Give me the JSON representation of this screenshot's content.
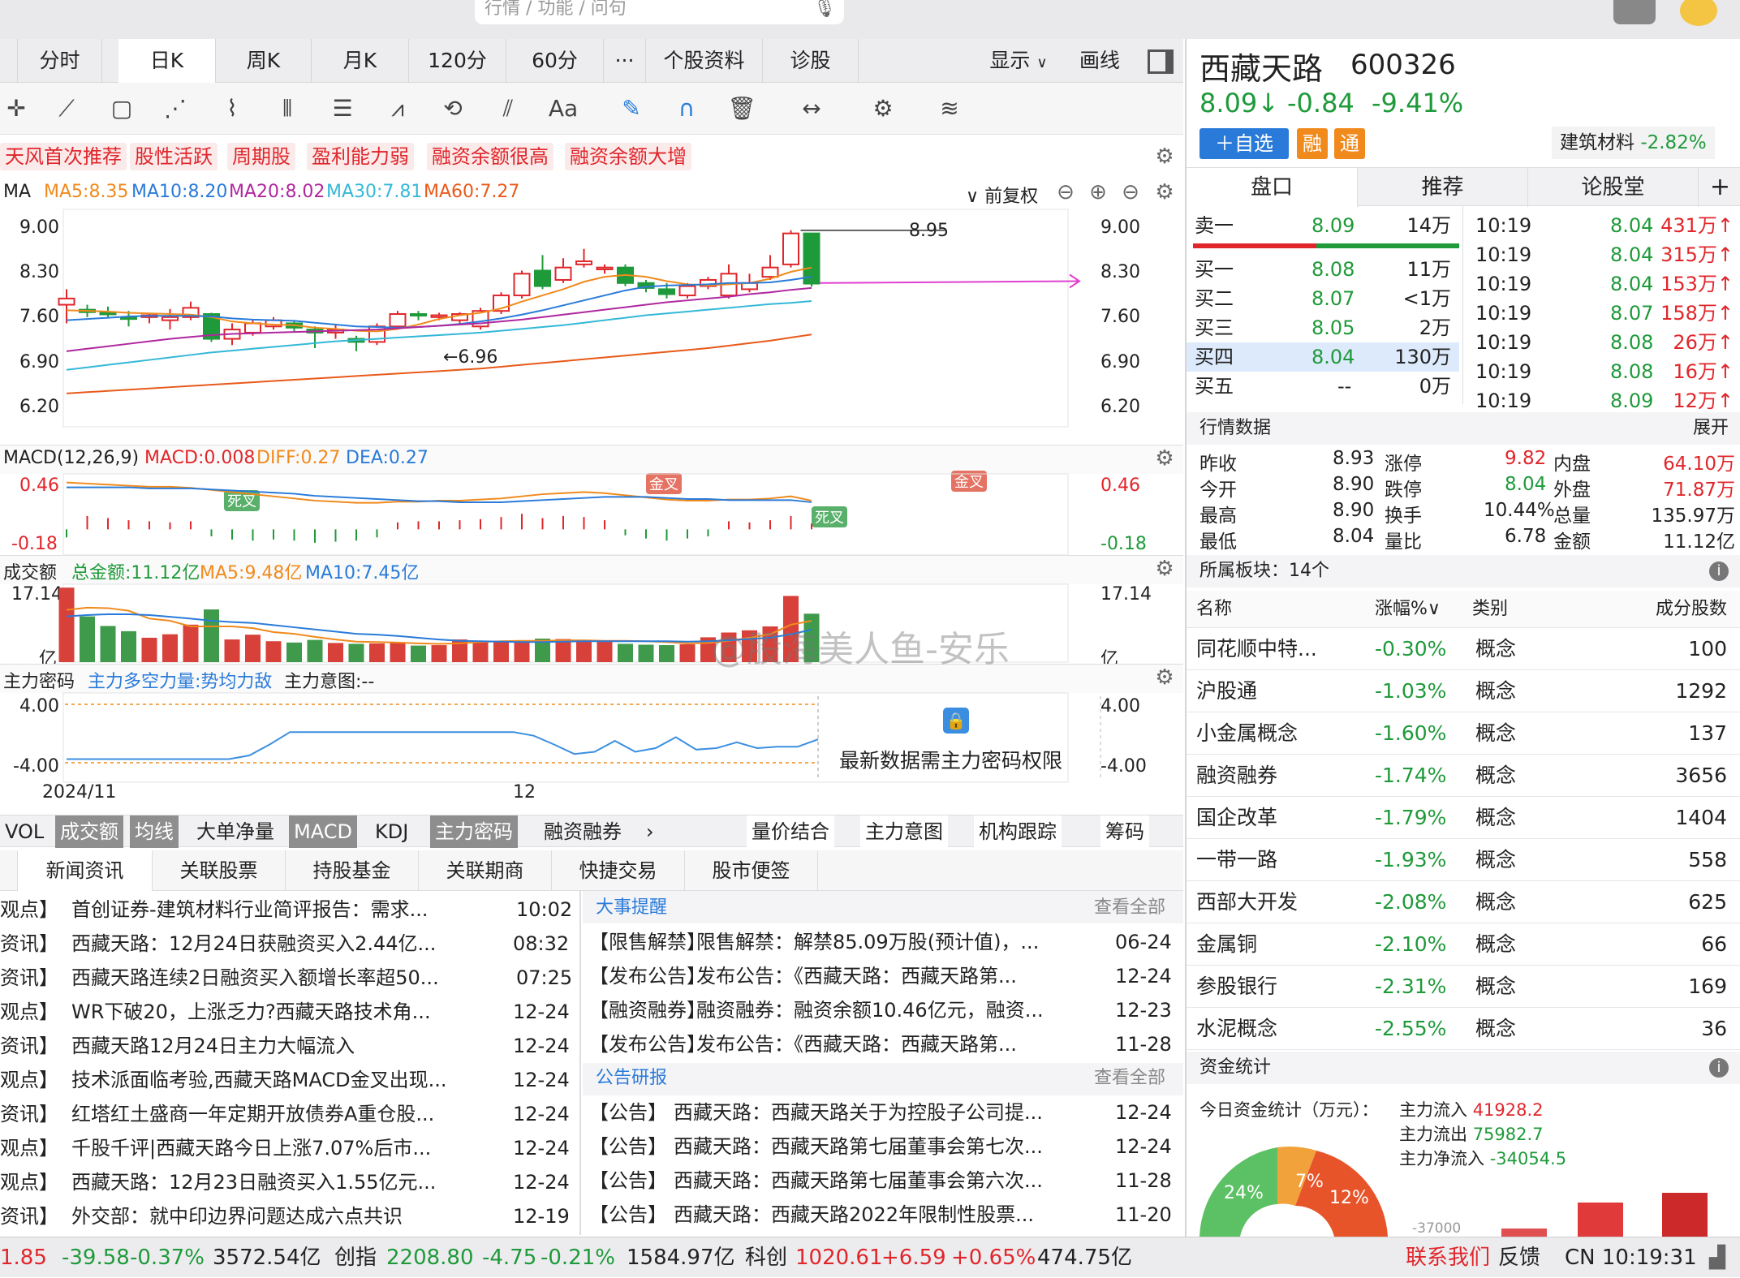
{
  "search": {
    "placeholder": "行情 / 功能 / 问句"
  },
  "period_tabs": [
    "分时",
    "日K",
    "周K",
    "月K",
    "120分",
    "60分",
    "···",
    "个股资料",
    "诊股"
  ],
  "top_right": {
    "display": "显示",
    "draw": "画线"
  },
  "tags": [
    "天风首次推荐",
    "股性活跃",
    "周期股",
    "盈利能力弱",
    "融资余额很高",
    "融资余额大增"
  ],
  "ma_bar": {
    "name": "MA",
    "ma5": "MA5:8.35",
    "ma10": "MA10:8.20",
    "ma20": "MA20:8.02",
    "ma30": "MA30:7.81",
    "ma60": "MA60:7.27",
    "adjust": "前复权"
  },
  "colors": {
    "up": "#e0262b",
    "down": "#1f9a3a",
    "ma5": "#f08a1c",
    "ma10": "#2a7bd9",
    "ma20": "#b0279f",
    "ma30": "#34b8d8",
    "ma60": "#e85a1a"
  },
  "chart_data": [
    {
      "type": "candlestick",
      "title": "日K",
      "ylim": [
        6.2,
        9.0
      ],
      "yticks": [
        "9.00",
        "8.30",
        "7.60",
        "6.90",
        "6.20"
      ],
      "annotations": [
        "8.95",
        "←6.96"
      ],
      "candles": [
        [
          7.75,
          7.85,
          7.45,
          8.0
        ],
        [
          7.67,
          7.63,
          7.55,
          7.75
        ],
        [
          7.62,
          7.6,
          7.55,
          7.72
        ],
        [
          7.55,
          7.52,
          7.4,
          7.65
        ],
        [
          7.55,
          7.58,
          7.45,
          7.62
        ],
        [
          7.5,
          7.55,
          7.35,
          7.68
        ],
        [
          7.55,
          7.7,
          7.5,
          7.8
        ],
        [
          7.6,
          7.2,
          7.15,
          7.62
        ],
        [
          7.2,
          7.35,
          7.1,
          7.45
        ],
        [
          7.3,
          7.45,
          7.25,
          7.5
        ],
        [
          7.4,
          7.5,
          7.35,
          7.55
        ],
        [
          7.45,
          7.38,
          7.3,
          7.5
        ],
        [
          7.35,
          7.3,
          7.05,
          7.4
        ],
        [
          7.3,
          7.35,
          7.2,
          7.42
        ],
        [
          7.2,
          7.15,
          7.0,
          7.25
        ],
        [
          7.15,
          7.4,
          7.1,
          7.45
        ],
        [
          7.4,
          7.6,
          7.35,
          7.65
        ],
        [
          7.6,
          7.58,
          7.5,
          7.65
        ],
        [
          7.55,
          7.58,
          7.5,
          7.62
        ],
        [
          7.5,
          7.6,
          7.45,
          7.63
        ],
        [
          7.4,
          7.65,
          7.35,
          7.7
        ],
        [
          7.65,
          7.9,
          7.6,
          7.95
        ],
        [
          7.9,
          8.25,
          7.85,
          8.3
        ],
        [
          8.3,
          8.05,
          8.0,
          8.55
        ],
        [
          8.15,
          8.35,
          8.1,
          8.5
        ],
        [
          8.4,
          8.45,
          8.35,
          8.65
        ],
        [
          8.32,
          8.35,
          8.25,
          8.4
        ],
        [
          8.35,
          8.1,
          8.05,
          8.4
        ],
        [
          8.1,
          8.02,
          7.95,
          8.15
        ],
        [
          8.0,
          7.92,
          7.85,
          8.1
        ],
        [
          7.9,
          8.05,
          7.85,
          8.1
        ],
        [
          8.05,
          8.15,
          8.0,
          8.2
        ],
        [
          7.9,
          8.25,
          7.85,
          8.4
        ],
        [
          8.0,
          8.1,
          7.95,
          8.25
        ],
        [
          8.2,
          8.35,
          8.15,
          8.55
        ],
        [
          8.4,
          8.9,
          8.35,
          8.95
        ],
        [
          8.9,
          8.09,
          8.04,
          8.9
        ]
      ],
      "series": [
        {
          "name": "MA5",
          "values": [
            7.66,
            7.65,
            7.64,
            7.62,
            7.61,
            7.6,
            7.59,
            7.55,
            7.48,
            7.45,
            7.43,
            7.42,
            7.38,
            7.36,
            7.33,
            7.32,
            7.36,
            7.43,
            7.52,
            7.58,
            7.62,
            7.69,
            7.8,
            7.9,
            8.0,
            8.12,
            8.2,
            8.23,
            8.2,
            8.13,
            8.08,
            8.06,
            8.08,
            8.1,
            8.17,
            8.28,
            8.35
          ]
        },
        {
          "name": "MA10",
          "values": [
            7.5,
            7.52,
            7.54,
            7.56,
            7.57,
            7.57,
            7.57,
            7.56,
            7.53,
            7.51,
            7.5,
            7.49,
            7.46,
            7.43,
            7.4,
            7.39,
            7.38,
            7.39,
            7.41,
            7.44,
            7.48,
            7.53,
            7.59,
            7.66,
            7.74,
            7.82,
            7.9,
            7.98,
            8.04,
            8.06,
            8.07,
            8.08,
            8.1,
            8.1,
            8.11,
            8.15,
            8.2
          ]
        },
        {
          "name": "MA20",
          "values": [
            7.0,
            7.04,
            7.08,
            7.12,
            7.16,
            7.2,
            7.23,
            7.26,
            7.28,
            7.29,
            7.3,
            7.31,
            7.32,
            7.33,
            7.34,
            7.35,
            7.37,
            7.39,
            7.41,
            7.43,
            7.45,
            7.48,
            7.51,
            7.55,
            7.59,
            7.63,
            7.67,
            7.71,
            7.75,
            7.79,
            7.82,
            7.85,
            7.88,
            7.92,
            7.95,
            7.99,
            8.02
          ]
        },
        {
          "name": "MA30",
          "values": [
            6.7,
            6.74,
            6.78,
            6.82,
            6.86,
            6.9,
            6.94,
            6.98,
            7.01,
            7.04,
            7.07,
            7.1,
            7.13,
            7.16,
            7.18,
            7.2,
            7.22,
            7.24,
            7.26,
            7.28,
            7.3,
            7.33,
            7.36,
            7.39,
            7.42,
            7.46,
            7.5,
            7.54,
            7.58,
            7.61,
            7.64,
            7.67,
            7.7,
            7.73,
            7.76,
            7.78,
            7.81
          ]
        },
        {
          "name": "MA60",
          "values": [
            6.32,
            6.34,
            6.36,
            6.38,
            6.4,
            6.42,
            6.44,
            6.46,
            6.48,
            6.5,
            6.52,
            6.54,
            6.56,
            6.58,
            6.6,
            6.62,
            6.64,
            6.66,
            6.68,
            6.7,
            6.72,
            6.75,
            6.78,
            6.81,
            6.84,
            6.87,
            6.9,
            6.93,
            6.96,
            6.99,
            7.02,
            7.05,
            7.09,
            7.13,
            7.17,
            7.22,
            7.27
          ]
        }
      ]
    },
    {
      "type": "bar",
      "title": "MACD(12,26,9)",
      "legend": [
        "MACD:0.008",
        "DIFF:0.27",
        "DEA:0.27"
      ],
      "ylim": [
        -0.18,
        0.46
      ],
      "yticks": [
        "0.46",
        "-0.18"
      ],
      "annotations": [
        "死叉",
        "金叉",
        "死叉",
        "金叉"
      ],
      "values": [
        -0.03,
        0.08,
        0.06,
        0.04,
        0.03,
        0.02,
        0.03,
        -0.02,
        -0.05,
        -0.06,
        -0.05,
        -0.06,
        -0.08,
        -0.07,
        -0.06,
        -0.03,
        0.02,
        0.03,
        0.03,
        0.04,
        0.05,
        0.07,
        0.1,
        0.06,
        0.08,
        0.07,
        0.04,
        -0.01,
        -0.04,
        -0.06,
        -0.04,
        -0.02,
        0.03,
        0.02,
        0.04,
        0.08,
        0.008
      ],
      "series": [
        {
          "name": "DIFF",
          "values": [
            0.44,
            0.43,
            0.42,
            0.41,
            0.4,
            0.4,
            0.39,
            0.37,
            0.35,
            0.33,
            0.31,
            0.29,
            0.27,
            0.26,
            0.25,
            0.25,
            0.26,
            0.26,
            0.27,
            0.27,
            0.28,
            0.29,
            0.31,
            0.33,
            0.34,
            0.35,
            0.34,
            0.32,
            0.3,
            0.28,
            0.27,
            0.27,
            0.28,
            0.28,
            0.29,
            0.31,
            0.27
          ]
        },
        {
          "name": "DEA",
          "values": [
            0.41,
            0.41,
            0.41,
            0.41,
            0.4,
            0.4,
            0.4,
            0.39,
            0.38,
            0.37,
            0.36,
            0.35,
            0.33,
            0.32,
            0.31,
            0.3,
            0.29,
            0.28,
            0.28,
            0.27,
            0.27,
            0.27,
            0.28,
            0.29,
            0.3,
            0.31,
            0.32,
            0.32,
            0.32,
            0.31,
            0.3,
            0.3,
            0.29,
            0.29,
            0.29,
            0.29,
            0.27
          ]
        }
      ]
    },
    {
      "type": "bar",
      "title": "成交额",
      "legend": [
        "总金额:11.12亿",
        "MA5:9.48亿",
        "MA10:7.45亿"
      ],
      "ylim": [
        0,
        17.14
      ],
      "yticks": [
        "17.14",
        "亿"
      ],
      "values": [
        17.1,
        10.5,
        8.3,
        7.1,
        5.6,
        6.4,
        8.6,
        12.1,
        5.2,
        6.3,
        4.8,
        4.5,
        5.1,
        4.4,
        4.2,
        4.3,
        4.6,
        3.8,
        3.9,
        5.2,
        4.8,
        4.6,
        4.9,
        5.4,
        5.3,
        4.8,
        4.7,
        4.2,
        4.0,
        3.9,
        4.1,
        5.7,
        6.8,
        7.3,
        8.2,
        15.2,
        11.12
      ],
      "series": [
        {
          "name": "MA5",
          "values": [
            12,
            12.5,
            12.4,
            11.8,
            10,
            9.5,
            8.2,
            8.2,
            8.2,
            7.8,
            6.9,
            6.5,
            5.8,
            5.2,
            4.7,
            4.6,
            4.5,
            4.3,
            4.2,
            4.3,
            4.6,
            4.8,
            4.9,
            4.9,
            5.0,
            5.0,
            4.9,
            4.9,
            4.8,
            4.6,
            4.3,
            4.4,
            4.9,
            5.6,
            6.4,
            8.6,
            9.48
          ]
        },
        {
          "name": "MA10",
          "values": [
            10.5,
            10.8,
            11,
            11,
            10.8,
            10.4,
            10,
            9.5,
            9.2,
            9,
            8.5,
            8,
            7.5,
            7,
            6.5,
            6.3,
            6,
            5.6,
            5.2,
            4.9,
            4.8,
            4.7,
            4.6,
            4.6,
            4.7,
            4.8,
            4.8,
            4.8,
            4.8,
            4.8,
            4.7,
            4.8,
            5,
            5.3,
            5.6,
            6.4,
            7.45
          ]
        }
      ]
    },
    {
      "type": "line",
      "title": "主力密码",
      "legend": [
        "主力多空力量:势均力敌",
        "主力意图:--"
      ],
      "ylim": [
        -4.0,
        4.0
      ],
      "yticks": [
        "4.00",
        "-4.00"
      ],
      "x_labels": [
        "2024/11",
        "12"
      ],
      "series": [
        {
          "name": "主力多空力量",
          "values": [
            -3.5,
            -3.5,
            -3.5,
            -3.5,
            -3.5,
            -3.5,
            -3.5,
            -3.5,
            -3.5,
            -3.0,
            -1.5,
            0.2,
            0.2,
            0.2,
            0.2,
            0.2,
            0.2,
            0.2,
            0.2,
            0.2,
            0.2,
            0.2,
            0.2,
            -0.3,
            -1.5,
            -2.8,
            -2.5,
            -1.0,
            -2.5,
            -2.0,
            -0.5,
            -2.2,
            -2.0,
            -1.2,
            -2.0,
            -1.8,
            -1.8,
            -0.8
          ]
        }
      ],
      "notice": "最新数据需主力密码权限"
    }
  ],
  "lower_tabs": [
    "VOL",
    "成交额",
    "均线",
    "大单净量",
    "MACD",
    "KDJ",
    "主力密码",
    "融资融券"
  ],
  "lower_tabs_right": [
    "量价结合",
    "主力意图",
    "机构跟踪",
    "筹码"
  ],
  "news_tabs": [
    "新闻资讯",
    "关联股票",
    "持股基金",
    "关联期商",
    "快捷交易",
    "股市便签"
  ],
  "news": [
    {
      "tag": "观点】",
      "title": "首创证券-建筑材料行业简评报告：需求...",
      "time": "10:02"
    },
    {
      "tag": "资讯】",
      "title": "西藏天路：12月24日获融资买入2.44亿...",
      "time": "08:32"
    },
    {
      "tag": "资讯】",
      "title": "西藏天路连续2日融资买入额增长率超50...",
      "time": "07:25"
    },
    {
      "tag": "观点】",
      "title": "WR下破20，上涨乏力?西藏天路技术角...",
      "time": "12-24"
    },
    {
      "tag": "资讯】",
      "title": "西藏天路12月24日主力大幅流入",
      "time": "12-24"
    },
    {
      "tag": "观点】",
      "title": "技术派面临考验,西藏天路MACD金叉出现...",
      "time": "12-24"
    },
    {
      "tag": "资讯】",
      "title": "红塔红土盛商一年定期开放债券A重仓股...",
      "time": "12-24"
    },
    {
      "tag": "观点】",
      "title": "千股千评|西藏天路今日上涨7.07%后市...",
      "time": "12-24"
    },
    {
      "tag": "观点】",
      "title": "西藏天路：12月23日融资买入1.55亿元...",
      "time": "12-24"
    },
    {
      "tag": "资讯】",
      "title": "外交部：就中印边界问题达成六点共识",
      "time": "12-19"
    }
  ],
  "events": {
    "header": "大事提醒",
    "more": "查看全部",
    "rows": [
      {
        "tag": "【限售解禁】",
        "title": "限售解禁：解禁85.09万股(预计值)，...",
        "time": "06-24"
      },
      {
        "tag": "【发布公告】",
        "title": "发布公告：《西藏天路：西藏天路第...",
        "time": "12-24"
      },
      {
        "tag": "【融资融券】",
        "title": "融资融券：融资余额10.46亿元，融资...",
        "time": "12-23"
      },
      {
        "tag": "【发布公告】",
        "title": "发布公告：《西藏天路：西藏天路第...",
        "time": "11-28"
      }
    ]
  },
  "reports": {
    "header": "公告研报",
    "more": "查看全部",
    "rows": [
      {
        "tag": "【公告】",
        "title": "西藏天路：西藏天路关于为控股子公司提...",
        "time": "12-24"
      },
      {
        "tag": "【公告】",
        "title": "西藏天路：西藏天路第七届董事会第七次...",
        "time": "12-24"
      },
      {
        "tag": "【公告】",
        "title": "西藏天路：西藏天路第七届董事会第六次...",
        "time": "11-28"
      },
      {
        "tag": "【公告】",
        "title": "西藏天路：西藏天路2022年限制性股票...",
        "time": "11-20"
      }
    ]
  },
  "watermark": "@股海美人鱼-安乐",
  "stock": {
    "name": "西藏天路",
    "code": "600326",
    "price": "8.09↓",
    "change": "-0.84",
    "pct": "-9.41%",
    "add_btn": "＋自选",
    "badge1": "融",
    "badge2": "通",
    "sector": "建筑材料",
    "sector_pct": "-2.82%"
  },
  "right_tabs": [
    "盘口",
    "推荐",
    "论股堂",
    "+"
  ],
  "orderbook": [
    {
      "label": "卖一",
      "price": "8.09",
      "vol": "14万"
    },
    {
      "label": "买一",
      "price": "8.08",
      "vol": "11万"
    },
    {
      "label": "买二",
      "price": "8.07",
      "vol": "<1万"
    },
    {
      "label": "买三",
      "price": "8.05",
      "vol": "2万"
    },
    {
      "label": "买四",
      "price": "8.04",
      "vol": "130万"
    },
    {
      "label": "买五",
      "price": "--",
      "vol": "0万"
    }
  ],
  "ticks": [
    {
      "time": "10:19",
      "price": "8.04",
      "vol": "431万↑"
    },
    {
      "time": "10:19",
      "price": "8.04",
      "vol": "315万↑"
    },
    {
      "time": "10:19",
      "price": "8.04",
      "vol": "153万↑"
    },
    {
      "time": "10:19",
      "price": "8.07",
      "vol": "158万↑"
    },
    {
      "time": "10:19",
      "price": "8.08",
      "vol": "26万↑"
    },
    {
      "time": "10:19",
      "price": "8.08",
      "vol": "16万↑"
    },
    {
      "time": "10:19",
      "price": "8.09",
      "vol": "12万↑"
    }
  ],
  "quote_header": {
    "title": "行情数据",
    "expand": "展开"
  },
  "quote": [
    [
      "昨收",
      "8.93",
      "涨停",
      "9.82",
      "内盘",
      "64.10万"
    ],
    [
      "今开",
      "8.90",
      "跌停",
      "8.04",
      "外盘",
      "71.87万"
    ],
    [
      "最高",
      "8.90",
      "换手",
      "10.44%",
      "总量",
      "135.97万"
    ],
    [
      "最低",
      "8.04",
      "量比",
      "6.78",
      "金额",
      "11.12亿"
    ]
  ],
  "plates_header": "所属板块：14个",
  "plates_cols": [
    "名称",
    "涨幅%",
    "类别",
    "成分股数"
  ],
  "plates": [
    {
      "name": "同花顺中特...",
      "pct": "-0.30%",
      "type": "概念",
      "count": "100"
    },
    {
      "name": "沪股通",
      "pct": "-1.03%",
      "type": "概念",
      "count": "1292"
    },
    {
      "name": "小金属概念",
      "pct": "-1.60%",
      "type": "概念",
      "count": "137"
    },
    {
      "name": "融资融券",
      "pct": "-1.74%",
      "type": "概念",
      "count": "3656"
    },
    {
      "name": "国企改革",
      "pct": "-1.79%",
      "type": "概念",
      "count": "1404"
    },
    {
      "name": "一带一路",
      "pct": "-1.93%",
      "type": "概念",
      "count": "558"
    },
    {
      "name": "西部大开发",
      "pct": "-2.08%",
      "type": "概念",
      "count": "625"
    },
    {
      "name": "金属铜",
      "pct": "-2.10%",
      "type": "概念",
      "count": "66"
    },
    {
      "name": "参股银行",
      "pct": "-2.31%",
      "type": "概念",
      "count": "169"
    },
    {
      "name": "水泥概念",
      "pct": "-2.55%",
      "type": "概念",
      "count": "36"
    }
  ],
  "fund": {
    "header": "资金统计",
    "label": "今日资金统计（万元）：",
    "in_label": "主力流入",
    "in_val": "41928.2",
    "out_label": "主力流出",
    "out_val": "75982.7",
    "net_label": "主力净流入",
    "net_val": "-34054.5",
    "p1": "24%",
    "p2": "7%",
    "p3": "12%",
    "axis": "-37000"
  },
  "status": {
    "idx1": "1.85",
    "idx1_chg": "-39.58",
    "idx1_pct": "-0.37%",
    "idx1_amt": "3572.54亿",
    "cy": "创指",
    "cy_val": "2208.80",
    "cy_chg": "-4.75",
    "cy_pct": "-0.21%",
    "cy_amt": "1584.97亿",
    "kc": "科创",
    "kc_val": "1020.61",
    "kc_chg": "+6.59",
    "kc_pct": "+0.65%",
    "kc_amt": "474.75亿",
    "contact": "联系我们",
    "feedback": "反馈",
    "clock": "CN 10:19:31"
  }
}
